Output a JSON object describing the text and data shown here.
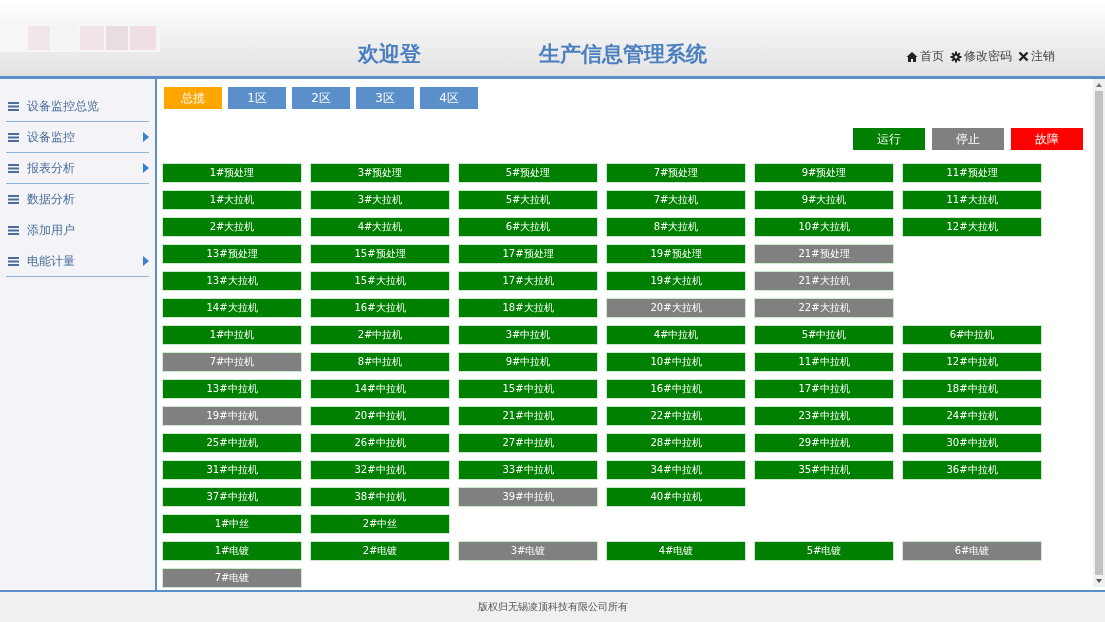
{
  "header": {
    "title_start": "欢迎登",
    "title_end": "生产信息管理系统",
    "links": [
      {
        "kind": "home",
        "label": "首页"
      },
      {
        "kind": "settings",
        "label": "修改密码"
      },
      {
        "kind": "close",
        "label": "注销"
      }
    ]
  },
  "sidebar": {
    "items": [
      {
        "label": "设备监控总览",
        "has_submenu": false,
        "divider": true
      },
      {
        "label": "设备监控",
        "has_submenu": true,
        "divider": true
      },
      {
        "label": "报表分析",
        "has_submenu": true,
        "divider": true
      },
      {
        "label": "数据分析",
        "has_submenu": false,
        "divider": false
      },
      {
        "label": "添加用户",
        "has_submenu": false,
        "divider": false
      },
      {
        "label": "电能计量",
        "has_submenu": true,
        "divider": true
      }
    ]
  },
  "tabs": [
    {
      "label": "总揽",
      "selected": true
    },
    {
      "label": "1区",
      "selected": false
    },
    {
      "label": "2区",
      "selected": false
    },
    {
      "label": "3区",
      "selected": false
    },
    {
      "label": "4区",
      "selected": false
    }
  ],
  "legend": [
    {
      "label": "运行",
      "color": "#008000"
    },
    {
      "label": "停止",
      "color": "#808080"
    },
    {
      "label": "故障",
      "color": "#ff0000"
    }
  ],
  "device_rows": [
    [
      {
        "label": "1#预处理",
        "color": "#008000"
      },
      {
        "label": "3#预处理",
        "color": "#008000"
      },
      {
        "label": "5#预处理",
        "color": "#008000"
      },
      {
        "label": "7#预处理",
        "color": "#008000"
      },
      {
        "label": "9#预处理",
        "color": "#008000"
      },
      {
        "label": "11#预处理",
        "color": "#008000"
      }
    ],
    [
      {
        "label": "1#大拉机",
        "color": "#008000"
      },
      {
        "label": "3#大拉机",
        "color": "#008000"
      },
      {
        "label": "5#大拉机",
        "color": "#008000"
      },
      {
        "label": "7#大拉机",
        "color": "#008000"
      },
      {
        "label": "9#大拉机",
        "color": "#008000"
      },
      {
        "label": "11#大拉机",
        "color": "#008000"
      }
    ],
    [
      {
        "label": "2#大拉机",
        "color": "#008000"
      },
      {
        "label": "4#大拉机",
        "color": "#008000"
      },
      {
        "label": "6#大拉机",
        "color": "#008000"
      },
      {
        "label": "8#大拉机",
        "color": "#008000"
      },
      {
        "label": "10#大拉机",
        "color": "#008000"
      },
      {
        "label": "12#大拉机",
        "color": "#008000"
      }
    ],
    [
      {
        "label": "13#预处理",
        "color": "#008000"
      },
      {
        "label": "15#预处理",
        "color": "#008000"
      },
      {
        "label": "17#预处理",
        "color": "#008000"
      },
      {
        "label": "19#预处理",
        "color": "#008000"
      },
      {
        "label": "21#预处理",
        "color": "#808080"
      }
    ],
    [
      {
        "label": "13#大拉机",
        "color": "#008000"
      },
      {
        "label": "15#大拉机",
        "color": "#008000"
      },
      {
        "label": "17#大拉机",
        "color": "#008000"
      },
      {
        "label": "19#大拉机",
        "color": "#008000"
      },
      {
        "label": "21#大拉机",
        "color": "#808080"
      }
    ],
    [
      {
        "label": "14#大拉机",
        "color": "#008000"
      },
      {
        "label": "16#大拉机",
        "color": "#008000"
      },
      {
        "label": "18#大拉机",
        "color": "#008000"
      },
      {
        "label": "20#大拉机",
        "color": "#808080"
      },
      {
        "label": "22#大拉机",
        "color": "#808080"
      }
    ],
    [
      {
        "label": "1#中拉机",
        "color": "#008000"
      },
      {
        "label": "2#中拉机",
        "color": "#008000"
      },
      {
        "label": "3#中拉机",
        "color": "#008000"
      },
      {
        "label": "4#中拉机",
        "color": "#008000"
      },
      {
        "label": "5#中拉机",
        "color": "#008000"
      },
      {
        "label": "6#中拉机",
        "color": "#008000"
      }
    ],
    [
      {
        "label": "7#中拉机",
        "color": "#808080"
      },
      {
        "label": "8#中拉机",
        "color": "#008000"
      },
      {
        "label": "9#中拉机",
        "color": "#008000"
      },
      {
        "label": "10#中拉机",
        "color": "#008000"
      },
      {
        "label": "11#中拉机",
        "color": "#008000"
      },
      {
        "label": "12#中拉机",
        "color": "#008000"
      }
    ],
    [
      {
        "label": "13#中拉机",
        "color": "#008000"
      },
      {
        "label": "14#中拉机",
        "color": "#008000"
      },
      {
        "label": "15#中拉机",
        "color": "#008000"
      },
      {
        "label": "16#中拉机",
        "color": "#008000"
      },
      {
        "label": "17#中拉机",
        "color": "#008000"
      },
      {
        "label": "18#中拉机",
        "color": "#008000"
      }
    ],
    [
      {
        "label": "19#中拉机",
        "color": "#808080"
      },
      {
        "label": "20#中拉机",
        "color": "#008000"
      },
      {
        "label": "21#中拉机",
        "color": "#008000"
      },
      {
        "label": "22#中拉机",
        "color": "#008000"
      },
      {
        "label": "23#中拉机",
        "color": "#008000"
      },
      {
        "label": "24#中拉机",
        "color": "#008000"
      }
    ],
    [
      {
        "label": "25#中拉机",
        "color": "#008000"
      },
      {
        "label": "26#中拉机",
        "color": "#008000"
      },
      {
        "label": "27#中拉机",
        "color": "#008000"
      },
      {
        "label": "28#中拉机",
        "color": "#008000"
      },
      {
        "label": "29#中拉机",
        "color": "#008000"
      },
      {
        "label": "30#中拉机",
        "color": "#008000"
      }
    ],
    [
      {
        "label": "31#中拉机",
        "color": "#008000"
      },
      {
        "label": "32#中拉机",
        "color": "#008000"
      },
      {
        "label": "33#中拉机",
        "color": "#008000"
      },
      {
        "label": "34#中拉机",
        "color": "#008000"
      },
      {
        "label": "35#中拉机",
        "color": "#008000"
      },
      {
        "label": "36#中拉机",
        "color": "#008000"
      }
    ],
    [
      {
        "label": "37#中拉机",
        "color": "#008000"
      },
      {
        "label": "38#中拉机",
        "color": "#008000"
      },
      {
        "label": "39#中拉机",
        "color": "#808080"
      },
      {
        "label": "40#中拉机",
        "color": "#008000"
      }
    ],
    [
      {
        "label": "1#中丝",
        "color": "#008000"
      },
      {
        "label": "2#中丝",
        "color": "#008000"
      }
    ],
    [
      {
        "label": "1#电镀",
        "color": "#008000"
      },
      {
        "label": "2#电镀",
        "color": "#008000"
      },
      {
        "label": "3#电镀",
        "color": "#808080"
      },
      {
        "label": "4#电镀",
        "color": "#008000"
      },
      {
        "label": "5#电镀",
        "color": "#008000"
      },
      {
        "label": "6#电镀",
        "color": "#808080"
      }
    ],
    [
      {
        "label": "7#电镀",
        "color": "#808080"
      }
    ]
  ],
  "footer": {
    "text": "版权归无锡凌顶科技有限公司所有"
  }
}
